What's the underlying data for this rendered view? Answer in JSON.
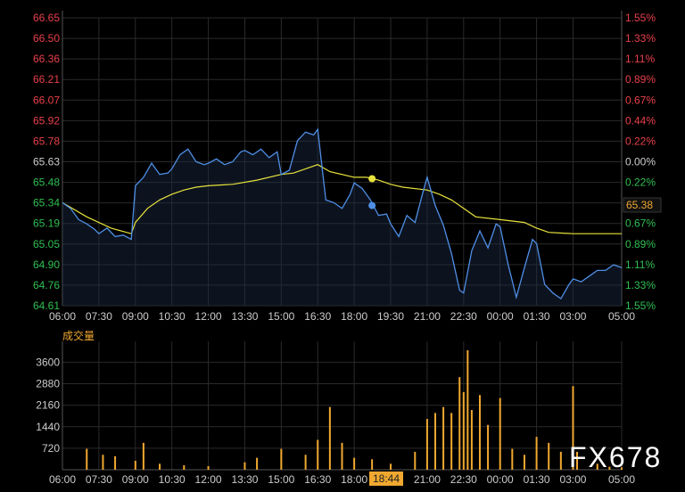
{
  "colors": {
    "background": "#000000",
    "grid": "#2a2a2a",
    "price_line": "#4f8fe6",
    "avg_line": "#e8e23c",
    "up_label": "#e8404a",
    "down_label": "#2fbf52",
    "neutral_label": "#cccccc",
    "volume_bar": "#f0a830",
    "time_label": "#cccccc",
    "cursor_label_bg": "#f0a830",
    "current_price_bg": "#111111",
    "current_price_text": "#f0a830",
    "volume_title": "#f0a830",
    "watermark": "#ffffff"
  },
  "price_ticks_left": [
    "66.65",
    "66.50",
    "66.36",
    "66.21",
    "66.07",
    "65.92",
    "65.78",
    "65.63",
    "65.48",
    "65.34",
    "65.19",
    "65.05",
    "64.90",
    "64.76",
    "64.61"
  ],
  "pct_ticks_right": [
    "1.55%",
    "1.33%",
    "1.11%",
    "0.89%",
    "0.67%",
    "0.44%",
    "0.22%",
    "0.00%",
    "0.22%",
    "0.44%",
    "0.67%",
    "0.89%",
    "1.11%",
    "1.33%",
    "1.55%"
  ],
  "time_ticks": [
    "06:00",
    "07:30",
    "09:00",
    "10:30",
    "12:00",
    "13:30",
    "15:00",
    "16:30",
    "18:00",
    "19:30",
    "21:00",
    "22:30",
    "00:00",
    "01:30",
    "03:00",
    "05:00"
  ],
  "bottom_time_ticks": [
    "06:00",
    "07:30",
    "09:00",
    "10:30",
    "12:00",
    "13:30",
    "15:00",
    "16:30",
    "18:00",
    "21:00",
    "22:30",
    "00:00",
    "01:30",
    "03:00",
    "05:00"
  ],
  "volume_title": "成交量",
  "volume_ticks": [
    "3600",
    "2880",
    "2160",
    "1440",
    "720"
  ],
  "current_price_label": "65.38",
  "cursor_time_label": "18:44",
  "watermark": "FX678",
  "chart_data": {
    "type": "line",
    "title": "",
    "price_range": [
      64.61,
      66.65
    ],
    "prev_close": 65.63,
    "price_series": {
      "x": [
        "06:00",
        "06:20",
        "06:40",
        "07:00",
        "07:20",
        "07:30",
        "07:50",
        "08:10",
        "08:30",
        "08:50",
        "09:00",
        "09:10",
        "09:20",
        "09:40",
        "10:00",
        "10:20",
        "10:30",
        "10:50",
        "11:10",
        "11:30",
        "11:50",
        "12:00",
        "12:20",
        "12:40",
        "13:00",
        "13:20",
        "13:30",
        "13:50",
        "14:10",
        "14:30",
        "14:50",
        "15:00",
        "15:20",
        "15:40",
        "16:00",
        "16:20",
        "16:30",
        "16:50",
        "17:10",
        "17:30",
        "17:50",
        "18:00",
        "18:20",
        "18:40",
        "19:00",
        "19:20",
        "19:30",
        "19:50",
        "20:10",
        "20:30",
        "20:50",
        "21:00",
        "21:20",
        "21:40",
        "22:00",
        "22:20",
        "22:30",
        "22:50",
        "23:10",
        "23:30",
        "23:50",
        "00:00",
        "00:20",
        "00:40",
        "01:00",
        "01:20",
        "01:30",
        "01:50",
        "02:10",
        "02:30",
        "02:50",
        "03:00",
        "03:20",
        "03:40",
        "04:00",
        "04:20",
        "04:40",
        "05:00"
      ],
      "y": [
        65.34,
        65.3,
        65.22,
        65.19,
        65.15,
        65.12,
        65.16,
        65.1,
        65.11,
        65.08,
        65.46,
        65.49,
        65.52,
        65.62,
        65.54,
        65.55,
        65.58,
        65.68,
        65.72,
        65.63,
        65.61,
        65.62,
        65.65,
        65.61,
        65.63,
        65.7,
        65.71,
        65.68,
        65.72,
        65.66,
        65.7,
        65.54,
        65.57,
        65.78,
        65.84,
        65.82,
        65.86,
        65.36,
        65.34,
        65.3,
        65.4,
        65.48,
        65.44,
        65.36,
        65.25,
        65.26,
        65.19,
        65.1,
        65.25,
        65.2,
        65.42,
        65.52,
        65.32,
        65.18,
        64.98,
        64.72,
        64.7,
        65.0,
        65.14,
        65.02,
        65.19,
        65.17,
        64.9,
        64.67,
        64.88,
        65.08,
        65.05,
        64.76,
        64.7,
        64.66,
        64.76,
        64.8,
        64.78,
        64.82,
        64.86,
        64.86,
        64.9,
        64.88
      ]
    },
    "avg_series": {
      "x": [
        "06:00",
        "07:00",
        "08:00",
        "08:50",
        "09:00",
        "09:30",
        "10:00",
        "10:30",
        "11:00",
        "11:30",
        "12:00",
        "13:00",
        "14:00",
        "15:00",
        "15:30",
        "16:00",
        "16:30",
        "17:00",
        "18:00",
        "18:30",
        "19:00",
        "19:30",
        "20:00",
        "21:00",
        "21:30",
        "22:00",
        "22:30",
        "23:00",
        "00:00",
        "01:00",
        "01:30",
        "02:00",
        "03:00",
        "04:00",
        "05:00"
      ],
      "y": [
        65.34,
        65.24,
        65.16,
        65.12,
        65.2,
        65.3,
        65.36,
        65.4,
        65.43,
        65.45,
        65.46,
        65.47,
        65.5,
        65.54,
        65.55,
        65.58,
        65.61,
        65.56,
        65.52,
        65.52,
        65.5,
        65.47,
        65.45,
        65.43,
        65.4,
        65.36,
        65.3,
        65.24,
        65.22,
        65.2,
        65.16,
        65.13,
        65.12,
        65.12,
        65.12
      ]
    },
    "markers": [
      {
        "x": "18:44",
        "y": 65.51,
        "series": "avg"
      },
      {
        "x": "18:44",
        "y": 65.32,
        "series": "price"
      }
    ],
    "volume": {
      "ylim": [
        0,
        4000
      ],
      "bars": [
        {
          "x": "07:00",
          "v": 700
        },
        {
          "x": "07:40",
          "v": 500
        },
        {
          "x": "08:10",
          "v": 450
        },
        {
          "x": "09:00",
          "v": 300
        },
        {
          "x": "09:20",
          "v": 900
        },
        {
          "x": "10:00",
          "v": 200
        },
        {
          "x": "11:00",
          "v": 150
        },
        {
          "x": "12:00",
          "v": 120
        },
        {
          "x": "13:30",
          "v": 250
        },
        {
          "x": "14:00",
          "v": 400
        },
        {
          "x": "15:00",
          "v": 700
        },
        {
          "x": "16:00",
          "v": 500
        },
        {
          "x": "16:30",
          "v": 1000
        },
        {
          "x": "17:00",
          "v": 2100
        },
        {
          "x": "17:30",
          "v": 900
        },
        {
          "x": "18:00",
          "v": 400
        },
        {
          "x": "18:44",
          "v": 350
        },
        {
          "x": "19:30",
          "v": 200
        },
        {
          "x": "20:30",
          "v": 600
        },
        {
          "x": "21:00",
          "v": 1700
        },
        {
          "x": "21:20",
          "v": 1900
        },
        {
          "x": "21:40",
          "v": 2100
        },
        {
          "x": "22:00",
          "v": 1900
        },
        {
          "x": "22:20",
          "v": 3100
        },
        {
          "x": "22:30",
          "v": 2600
        },
        {
          "x": "22:40",
          "v": 4100
        },
        {
          "x": "22:50",
          "v": 2000
        },
        {
          "x": "23:10",
          "v": 2500
        },
        {
          "x": "23:30",
          "v": 1500
        },
        {
          "x": "00:00",
          "v": 2400
        },
        {
          "x": "00:30",
          "v": 700
        },
        {
          "x": "01:00",
          "v": 500
        },
        {
          "x": "01:30",
          "v": 1100
        },
        {
          "x": "02:00",
          "v": 900
        },
        {
          "x": "02:30",
          "v": 600
        },
        {
          "x": "03:00",
          "v": 2800
        },
        {
          "x": "03:10",
          "v": 600
        },
        {
          "x": "04:00",
          "v": 200
        },
        {
          "x": "04:30",
          "v": 100
        },
        {
          "x": "05:00",
          "v": 80
        }
      ]
    }
  }
}
